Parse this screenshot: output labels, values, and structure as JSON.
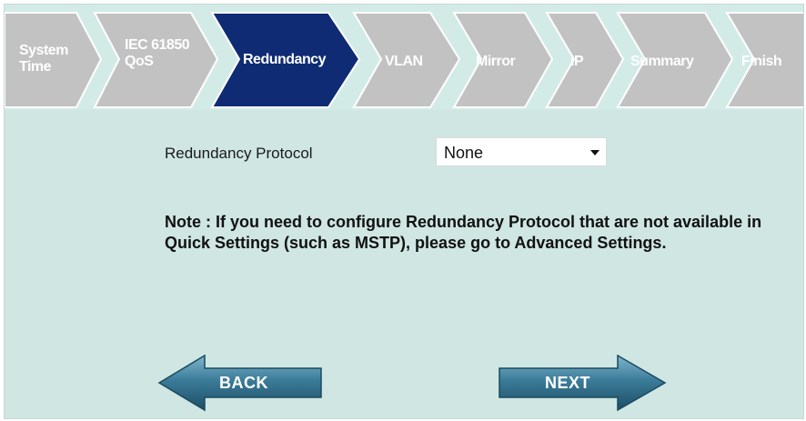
{
  "wizard": {
    "steps": [
      {
        "line1": "System",
        "line2": "Time",
        "active": false
      },
      {
        "line1": "IEC 61850",
        "line2": "QoS",
        "active": false
      },
      {
        "line1": "Redundancy",
        "line2": "",
        "active": true
      },
      {
        "line1": "VLAN",
        "line2": "",
        "active": false
      },
      {
        "line1": "Mirror",
        "line2": "",
        "active": false
      },
      {
        "line1": "IP",
        "line2": "",
        "active": false
      },
      {
        "line1": "Summary",
        "line2": "",
        "active": false
      },
      {
        "line1": "Finish",
        "line2": "",
        "active": false
      }
    ]
  },
  "form": {
    "protocol_label": "Redundancy Protocol",
    "protocol_value": "None"
  },
  "note": "Note : If you need to configure Redundancy Protocol that are not available in Quick Settings (such as MSTP), please go to Advanced Settings.",
  "buttons": {
    "back_label": "BACK",
    "next_label": "NEXT"
  },
  "colors": {
    "page_background": "#cfe6e3",
    "inactive_step": "#c3c3c3",
    "active_step": "#0f2b73",
    "arrow_button": "#2f6f8f"
  }
}
